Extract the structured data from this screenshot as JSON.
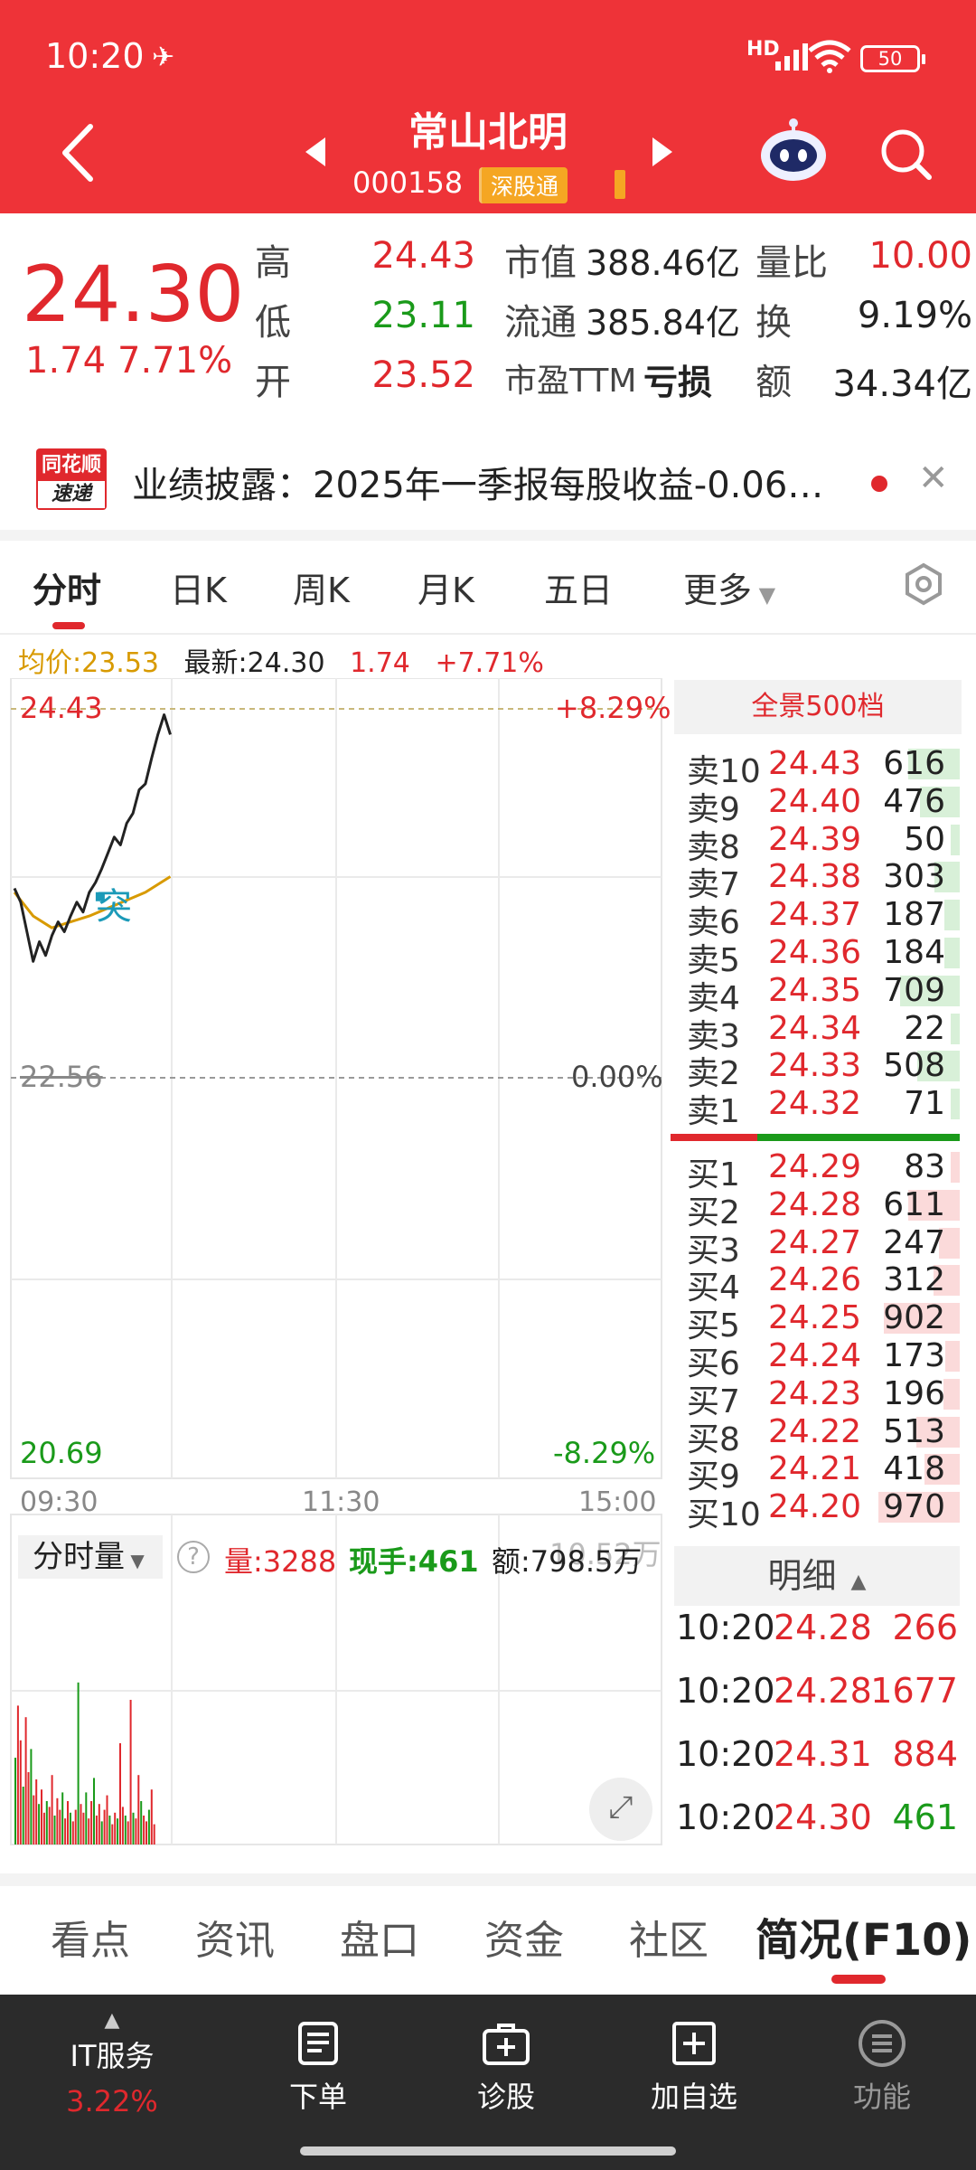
{
  "status_bar": {
    "time": "10:20",
    "network": "HD",
    "battery": "50"
  },
  "header": {
    "stock_name": "常山北明",
    "stock_code": "000158",
    "exchange_badge": "深股通"
  },
  "quote": {
    "price": "24.30",
    "change": "1.74",
    "change_pct": "7.71%",
    "high_label": "高",
    "high": "24.43",
    "low_label": "低",
    "low": "23.11",
    "open_label": "开",
    "open": "23.52",
    "mktcap_label": "市值",
    "mktcap": "388.46亿",
    "float_label": "流通",
    "float": "385.84亿",
    "pe_label": "市盈TTM",
    "pe": "亏损",
    "vol_ratio_label": "量比",
    "vol_ratio": "10.00",
    "turnover_label": "换",
    "turnover": "9.19%",
    "amount_label": "额",
    "amount": "34.34亿"
  },
  "banner": {
    "logo_top": "同花顺",
    "logo_bottom": "速递",
    "text": "业绩披露：2025年一季报每股收益-0.06…"
  },
  "tabs": [
    "分时",
    "日K",
    "周K",
    "月K",
    "五日",
    "更多"
  ],
  "statline": {
    "avg_label": "均价:23.53",
    "latest": "最新:24.30",
    "change": "1.74",
    "pct": "+7.71%"
  },
  "chart_data": {
    "type": "line",
    "title": "",
    "x_ticks": [
      "09:30",
      "11:30",
      "15:00"
    ],
    "ylim": [
      20.69,
      24.43
    ],
    "y_ticks_left": [
      "24.43",
      "22.56",
      "20.69"
    ],
    "y_ticks_right": [
      "+8.29%",
      "0.00%",
      "-8.29%"
    ],
    "series": [
      {
        "name": "",
        "x": [
          "09:30",
          "09:32",
          "09:34",
          "09:36",
          "09:38",
          "09:40",
          "09:42",
          "09:44",
          "09:46",
          "09:48",
          "09:50",
          "09:52",
          "09:54",
          "09:56",
          "09:58",
          "10:00",
          "10:02",
          "10:04",
          "10:06",
          "10:08",
          "10:10",
          "10:12",
          "10:14",
          "10:16",
          "10:18",
          "10:20"
        ],
        "values": [
          23.52,
          23.45,
          23.3,
          23.15,
          23.25,
          23.18,
          23.28,
          23.35,
          23.3,
          23.38,
          23.45,
          23.4,
          23.5,
          23.55,
          23.62,
          23.7,
          23.78,
          23.74,
          23.85,
          23.9,
          24.02,
          24.05,
          24.18,
          24.3,
          24.4,
          24.3
        ]
      },
      {
        "name": "",
        "x": [
          "09:30",
          "09:36",
          "09:42",
          "09:48",
          "09:54",
          "10:00",
          "10:06",
          "10:12",
          "10:20"
        ],
        "values": [
          23.5,
          23.38,
          23.32,
          23.35,
          23.38,
          23.42,
          23.46,
          23.5,
          23.58
        ]
      }
    ],
    "marker_label": "突",
    "volume": {
      "label": "分时量",
      "vol_label": "量:3288",
      "now_label": "现手:461",
      "amount_label": "额:798.5万",
      "scale_label": "10.52万",
      "bars": [
        60,
        96,
        72,
        40,
        88,
        50,
        66,
        34,
        45,
        28,
        38,
        22,
        30,
        26,
        48,
        20,
        32,
        24,
        36,
        18,
        30,
        22,
        16,
        24,
        112,
        28,
        22,
        36,
        18,
        30,
        46,
        20,
        28,
        16,
        24,
        34,
        20,
        14,
        22,
        18,
        70,
        26,
        20,
        16,
        100,
        22,
        18,
        48,
        30,
        20,
        16,
        24,
        38,
        14
      ]
    }
  },
  "orderbook": {
    "header": "全景500档",
    "sell": [
      {
        "label": "卖10",
        "price": "24.43",
        "vol": "616"
      },
      {
        "label": "卖9",
        "price": "24.40",
        "vol": "476"
      },
      {
        "label": "卖8",
        "price": "24.39",
        "vol": "50"
      },
      {
        "label": "卖7",
        "price": "24.38",
        "vol": "303"
      },
      {
        "label": "卖6",
        "price": "24.37",
        "vol": "187"
      },
      {
        "label": "卖5",
        "price": "24.36",
        "vol": "184"
      },
      {
        "label": "卖4",
        "price": "24.35",
        "vol": "709"
      },
      {
        "label": "卖3",
        "price": "24.34",
        "vol": "22"
      },
      {
        "label": "卖2",
        "price": "24.33",
        "vol": "508"
      },
      {
        "label": "卖1",
        "price": "24.32",
        "vol": "71"
      }
    ],
    "buy": [
      {
        "label": "买1",
        "price": "24.29",
        "vol": "83"
      },
      {
        "label": "买2",
        "price": "24.28",
        "vol": "611"
      },
      {
        "label": "买3",
        "price": "24.27",
        "vol": "247"
      },
      {
        "label": "买4",
        "price": "24.26",
        "vol": "312"
      },
      {
        "label": "买5",
        "price": "24.25",
        "vol": "902"
      },
      {
        "label": "买6",
        "price": "24.24",
        "vol": "173"
      },
      {
        "label": "买7",
        "price": "24.23",
        "vol": "196"
      },
      {
        "label": "买8",
        "price": "24.22",
        "vol": "513"
      },
      {
        "label": "买9",
        "price": "24.21",
        "vol": "418"
      },
      {
        "label": "买10",
        "price": "24.20",
        "vol": "970"
      }
    ]
  },
  "detail": {
    "header": "明细",
    "rows": [
      {
        "time": "10:20",
        "price": "24.28",
        "vol": "266",
        "dir": "sell"
      },
      {
        "time": "10:20",
        "price": "24.28",
        "vol": "1677",
        "dir": "sell"
      },
      {
        "time": "10:20",
        "price": "24.31",
        "vol": "884",
        "dir": "sell"
      },
      {
        "time": "10:20",
        "price": "24.30",
        "vol": "461",
        "dir": "buy"
      }
    ]
  },
  "section_tabs": [
    "看点",
    "资讯",
    "盘口",
    "资金",
    "社区",
    "简况(F10)"
  ],
  "bottom_bar": {
    "sector_name": "IT服务",
    "sector_pct": "3.22%",
    "items": [
      "下单",
      "诊股",
      "加自选",
      "功能"
    ]
  },
  "colors": {
    "header_red": "#ee3338",
    "up": "#e0282d",
    "down": "#1a9a1a",
    "avg_line": "#d89a00",
    "bottom_bar": "#2b2b2b"
  }
}
